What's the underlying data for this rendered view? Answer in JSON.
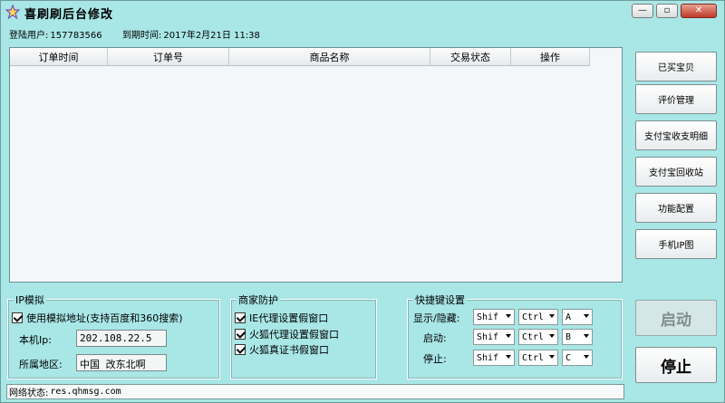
{
  "window": {
    "title": "喜刷刷后台修改",
    "min_glyph": "—",
    "max_glyph": "▫",
    "close_glyph": "✕"
  },
  "info": {
    "user_label": "登陆用户:",
    "user_value": "157783566",
    "expire_label": "到期时间:",
    "expire_value": "2017年2月21日 11:38"
  },
  "table": {
    "columns": [
      "订单时间",
      "订单号",
      "商品名称",
      "交易状态",
      "操作"
    ],
    "rows": []
  },
  "side_buttons": [
    "已买宝贝",
    "评价管理",
    "支付宝收支明细",
    "支付宝回收站",
    "功能配置",
    "手机IP图"
  ],
  "ip_group": {
    "title": "IP模拟",
    "use_sim_label": "使用模拟地址(支持百度和360搜索)",
    "use_sim_checked": true,
    "local_ip_label": "本机Ip:",
    "local_ip_value": "202.108.22.5",
    "region_label": "所属地区:",
    "region_value": "中国 改东北啊"
  },
  "guard_group": {
    "title": "商家防护",
    "items": [
      {
        "label": "IE代理设置假窗口",
        "checked": true
      },
      {
        "label": "火狐代理设置假窗口",
        "checked": true
      },
      {
        "label": "火狐真证书假窗口",
        "checked": true
      }
    ]
  },
  "hotkey_group": {
    "title": "快捷键设置",
    "rows": [
      {
        "label": "显示/隐藏:",
        "key1": "Shif",
        "key2": "Ctrl",
        "key3": "A"
      },
      {
        "label": "启动:",
        "key1": "Shif",
        "key2": "Ctrl",
        "key3": "B"
      },
      {
        "label": "停止:",
        "key1": "Shif",
        "key2": "Ctrl",
        "key3": "C"
      }
    ]
  },
  "actions": {
    "start_label": "启动",
    "stop_label": "停止"
  },
  "status": {
    "label": "网络状态:",
    "value": "res.qhmsg.com"
  },
  "colors": {
    "background": "#a9e6e6",
    "table_bg": "#f4f7fa",
    "close_button": "#c0392b",
    "disabled_text": "#7f8c8c"
  }
}
